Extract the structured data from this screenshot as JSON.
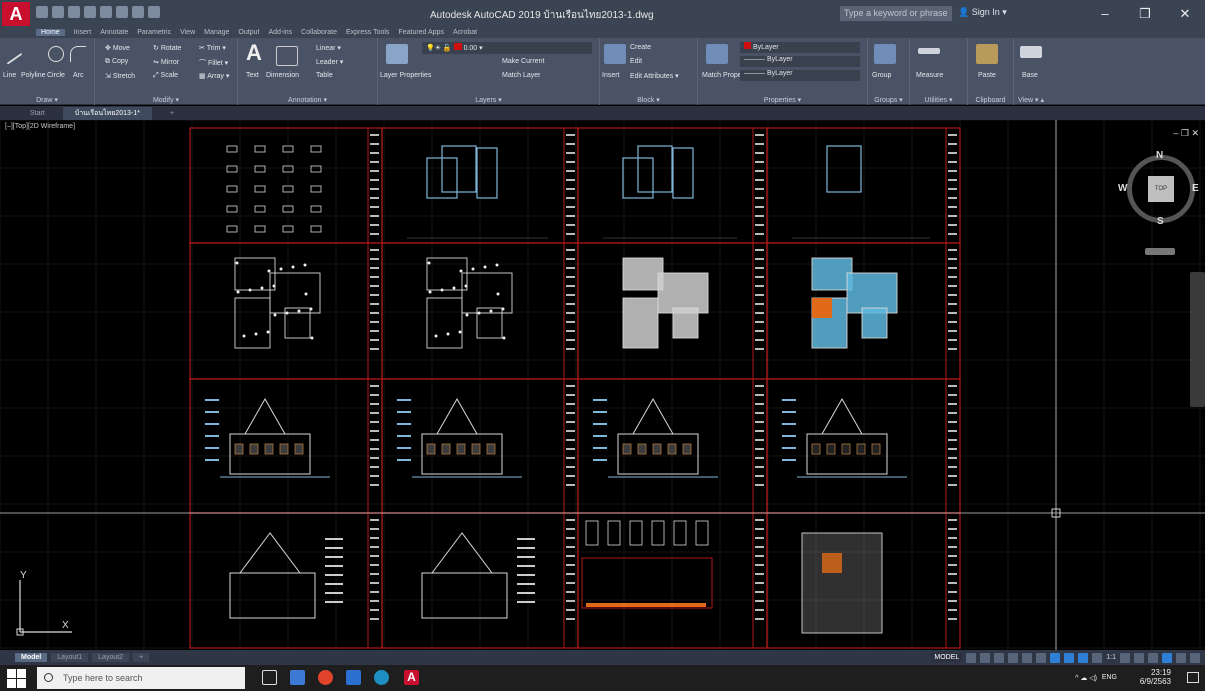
{
  "app": {
    "logo_letter": "A",
    "title": "Autodesk AutoCAD 2019  บ้านเรือนไทย2013-1.dwg",
    "search_placeholder": "Type a keyword or phrase",
    "sign_in": "Sign In",
    "window_controls": [
      "–",
      "❐",
      "✕"
    ]
  },
  "ribbon": {
    "tabs": [
      "Home",
      "Insert",
      "Annotate",
      "Parametric",
      "View",
      "Manage",
      "Output",
      "Add-ins",
      "Collaborate",
      "Express Tools",
      "Featured Apps",
      "Acrobat"
    ],
    "active_tab": "Home",
    "draw": {
      "title": "Draw ▾",
      "tools": [
        "Line",
        "Polyline",
        "Circle",
        "Arc"
      ]
    },
    "modify": {
      "title": "Modify ▾",
      "tools": [
        "Move",
        "Rotate",
        "Trim ▾",
        "Copy",
        "Mirror",
        "Fillet ▾",
        "Stretch",
        "Scale",
        "Array ▾"
      ]
    },
    "annotation": {
      "title": "Annotation ▾",
      "tools": [
        "Text",
        "Dimension",
        "Linear ▾",
        "Leader ▾",
        "Table"
      ]
    },
    "layers": {
      "title": "Layers ▾",
      "tools": [
        "Layer Properties",
        "Make Current",
        "Match Layer"
      ],
      "current_layer": "0.00"
    },
    "block": {
      "title": "Block ▾",
      "tools": [
        "Insert",
        "Create",
        "Edit",
        "Edit Attributes ▾"
      ]
    },
    "properties": {
      "title": "Properties ▾",
      "tools": [
        "Match Properties"
      ],
      "values": [
        "ByLayer",
        "ByLayer",
        "ByLayer"
      ]
    },
    "groups": {
      "title": "Groups ▾",
      "tools": [
        "Group"
      ]
    },
    "utilities": {
      "title": "Utilities ▾",
      "tools": [
        "Measure"
      ]
    },
    "clipboard": {
      "title": "Clipboard",
      "tools": [
        "Paste"
      ]
    },
    "view": {
      "title": "View ▾ ▴",
      "tools": [
        "Base"
      ]
    }
  },
  "doc_tabs": [
    "Start",
    "บ้านเรือนไทย2013-1*",
    "+"
  ],
  "viewport": {
    "label": "[–][Top][2D Wireframe]",
    "controls": "– ❐ ✕",
    "viewcube": {
      "face": "TOP",
      "north": "N",
      "south": "S",
      "east": "E",
      "west": "W"
    },
    "ucs": {
      "x": "X",
      "y": "Y"
    }
  },
  "layout_tabs": [
    "Model",
    "Layout1",
    "Layout2",
    "+"
  ],
  "status": {
    "model": "MODEL",
    "scale": "1:1"
  },
  "taskbar": {
    "search_placeholder": "Type here to search",
    "lang": "ENG",
    "time": "23:19",
    "date": "6/9/2563",
    "tray_misc": "^ ☁ ◁)"
  },
  "colors": {
    "accent": "#c8102e",
    "ribbon_bg": "#4a5366",
    "grid_red": "#b01818",
    "drawing_line": "#d8d8d8",
    "cyan_fill": "#5eb7dd",
    "orange_fill": "#e06a18"
  }
}
